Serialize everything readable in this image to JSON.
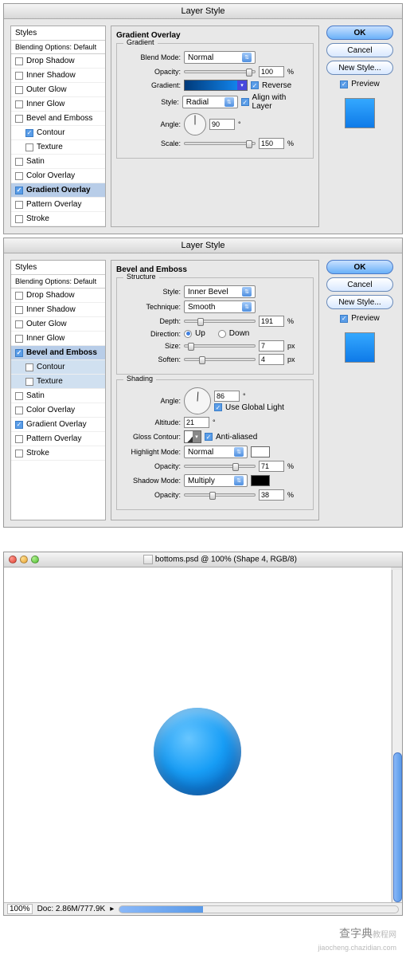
{
  "dialog_title": "Layer Style",
  "styles_header": "Styles",
  "styles_sub": "Blending Options: Default",
  "style_list": [
    {
      "label": "Drop Shadow",
      "checked": false
    },
    {
      "label": "Inner Shadow",
      "checked": false
    },
    {
      "label": "Outer Glow",
      "checked": false
    },
    {
      "label": "Inner Glow",
      "checked": false
    },
    {
      "label": "Bevel and Emboss",
      "checked": false
    },
    {
      "label": "Contour",
      "checked": true,
      "indent": true
    },
    {
      "label": "Texture",
      "checked": false,
      "indent": true
    },
    {
      "label": "Satin",
      "checked": false
    },
    {
      "label": "Color Overlay",
      "checked": false
    },
    {
      "label": "Gradient Overlay",
      "checked": true,
      "selected": true
    },
    {
      "label": "Pattern Overlay",
      "checked": false
    },
    {
      "label": "Stroke",
      "checked": false
    }
  ],
  "style_list2": [
    {
      "label": "Drop Shadow",
      "checked": false
    },
    {
      "label": "Inner Shadow",
      "checked": false
    },
    {
      "label": "Outer Glow",
      "checked": false
    },
    {
      "label": "Inner Glow",
      "checked": false
    },
    {
      "label": "Bevel and Emboss",
      "checked": true,
      "selected": true
    },
    {
      "label": "Contour",
      "checked": false,
      "indent": true,
      "sel2": true
    },
    {
      "label": "Texture",
      "checked": false,
      "indent": true,
      "sel2": true
    },
    {
      "label": "Satin",
      "checked": false
    },
    {
      "label": "Color Overlay",
      "checked": false
    },
    {
      "label": "Gradient Overlay",
      "checked": true
    },
    {
      "label": "Pattern Overlay",
      "checked": false
    },
    {
      "label": "Stroke",
      "checked": false
    }
  ],
  "buttons": {
    "ok": "OK",
    "cancel": "Cancel",
    "new_style": "New Style...",
    "preview": "Preview"
  },
  "gradient_overlay": {
    "title": "Gradient Overlay",
    "group": "Gradient",
    "blend_mode_label": "Blend Mode:",
    "blend_mode": "Normal",
    "opacity_label": "Opacity:",
    "opacity": "100",
    "opacity_unit": "%",
    "gradient_label": "Gradient:",
    "reverse": "Reverse",
    "style_label": "Style:",
    "style": "Radial",
    "align": "Align with Layer",
    "angle_label": "Angle:",
    "angle": "90",
    "angle_unit": "°",
    "scale_label": "Scale:",
    "scale": "150",
    "scale_unit": "%"
  },
  "bevel": {
    "title": "Bevel and Emboss",
    "structure": "Structure",
    "style_label": "Style:",
    "style": "Inner Bevel",
    "technique_label": "Technique:",
    "technique": "Smooth",
    "depth_label": "Depth:",
    "depth": "191",
    "depth_unit": "%",
    "direction_label": "Direction:",
    "up": "Up",
    "down": "Down",
    "size_label": "Size:",
    "size": "7",
    "size_unit": "px",
    "soften_label": "Soften:",
    "soften": "4",
    "soften_unit": "px",
    "shading": "Shading",
    "angle_label": "Angle:",
    "angle": "86",
    "angle_unit": "°",
    "global": "Use Global Light",
    "altitude_label": "Altitude:",
    "altitude": "21",
    "altitude_unit": "°",
    "gloss_label": "Gloss Contour:",
    "anti": "Anti-aliased",
    "highlight_label": "Highlight Mode:",
    "highlight": "Normal",
    "h_opacity_label": "Opacity:",
    "h_opacity": "71",
    "h_opacity_unit": "%",
    "h_color": "#ffffff",
    "shadow_label": "Shadow Mode:",
    "shadow": "Multiply",
    "s_opacity_label": "Opacity:",
    "s_opacity": "38",
    "s_opacity_unit": "%",
    "s_color": "#000000"
  },
  "doc": {
    "title": "bottoms.psd @ 100% (Shape 4, RGB/8)",
    "zoom": "100%",
    "status": "Doc: 2.86M/777.9K"
  },
  "watermark": {
    "cn": "查字典",
    "rest": "教程网",
    "url": "jiaocheng.chazidian.com"
  }
}
